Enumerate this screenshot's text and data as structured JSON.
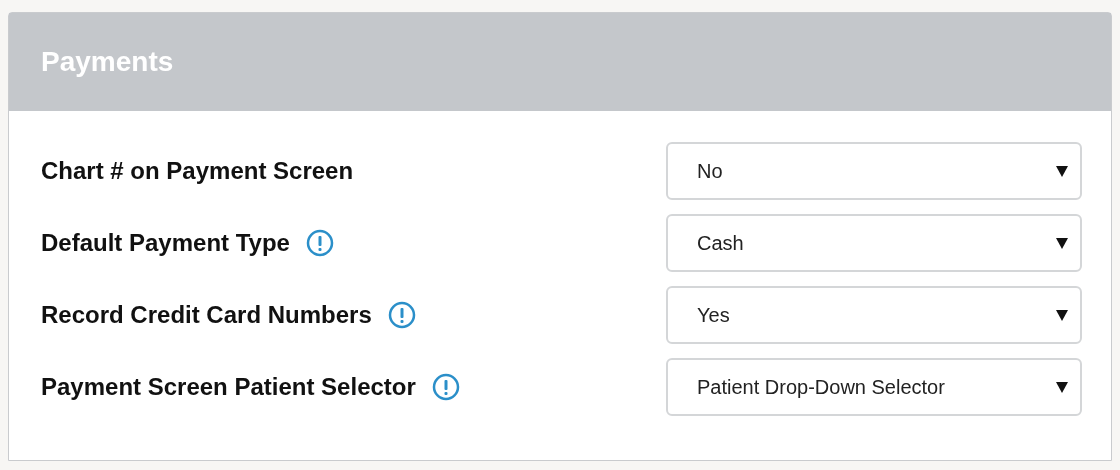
{
  "panel": {
    "title": "Payments"
  },
  "settings": [
    {
      "label": "Chart # on Payment Screen",
      "info": false,
      "value": "No"
    },
    {
      "label": "Default Payment Type",
      "info": true,
      "value": "Cash"
    },
    {
      "label": "Record Credit Card Numbers",
      "info": true,
      "value": "Yes"
    },
    {
      "label": "Payment Screen Patient Selector",
      "info": true,
      "value": "Patient Drop-Down Selector"
    }
  ]
}
